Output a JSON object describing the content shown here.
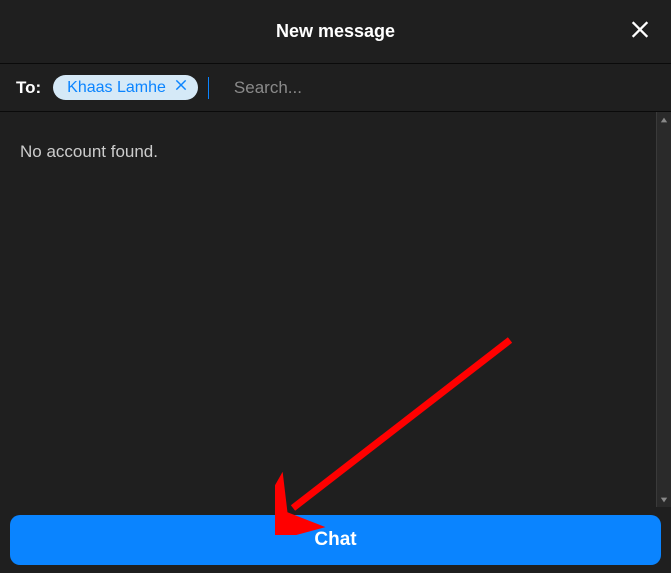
{
  "header": {
    "title": "New message"
  },
  "compose": {
    "to_label": "To:",
    "recipients": [
      {
        "name": "Khaas Lamhe"
      }
    ],
    "search_placeholder": "Search..."
  },
  "results": {
    "empty_text": "No account found."
  },
  "action": {
    "chat_button": "Chat"
  }
}
